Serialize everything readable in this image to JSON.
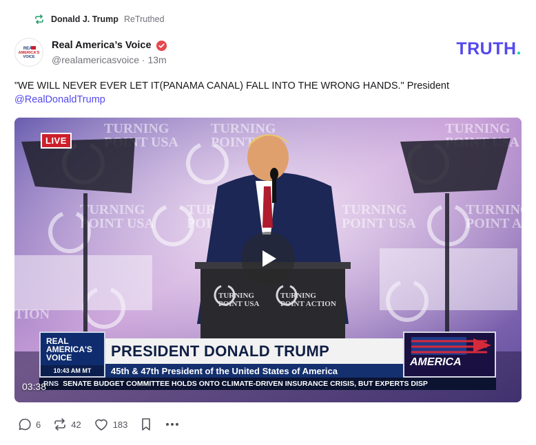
{
  "retruth": {
    "user": "Donald J. Trump",
    "label": "ReTruthed",
    "icon": "retruth-icon"
  },
  "account": {
    "name": "Real America’s Voice",
    "handle_time": "@realamericasvoice · 13m",
    "avatar_text": "REAL AMERICA'S VOICE",
    "verified_icon": "verified-badge-icon"
  },
  "brand": {
    "logo": "TRUTH",
    "logo_dot": ".",
    "color": "#5448ee",
    "dot_color": "#17d2a8"
  },
  "post": {
    "text": "\"WE WILL NEVER EVER LET IT(PANAMA CANAL) FALL INTO THE WRONG HANDS.\" President",
    "mention": "@RealDonaldTrump"
  },
  "video": {
    "live_badge": "LIVE",
    "duration": "03:38",
    "play_icon": "play-icon",
    "lower_third": {
      "logo_line1": "REAL",
      "logo_line2": "AMERICA'S",
      "logo_line3": "VOICE",
      "time": "10:43 AM MT",
      "headline": "PRESIDENT DONALD TRUMP",
      "subline": "45th & 47th President of the United States of America",
      "side_graphic": "AMERICA"
    },
    "ticker": {
      "tag": "RNS",
      "text": "SENATE BUDGET COMMITTEE HOLDS ONTO CLIMATE-DRIVEN INSURANCE CRISIS, BUT EXPERTS DISP"
    },
    "backdrop_texts": [
      "TURNING POINT USA",
      "TURNING POINT ACTION"
    ]
  },
  "actions": {
    "replies": "6",
    "retruths": "42",
    "likes": "183",
    "reply_icon": "reply-icon",
    "retruth_icon": "retruth-icon",
    "like_icon": "heart-icon",
    "bookmark_icon": "bookmark-icon",
    "more_icon": "more-icon"
  }
}
